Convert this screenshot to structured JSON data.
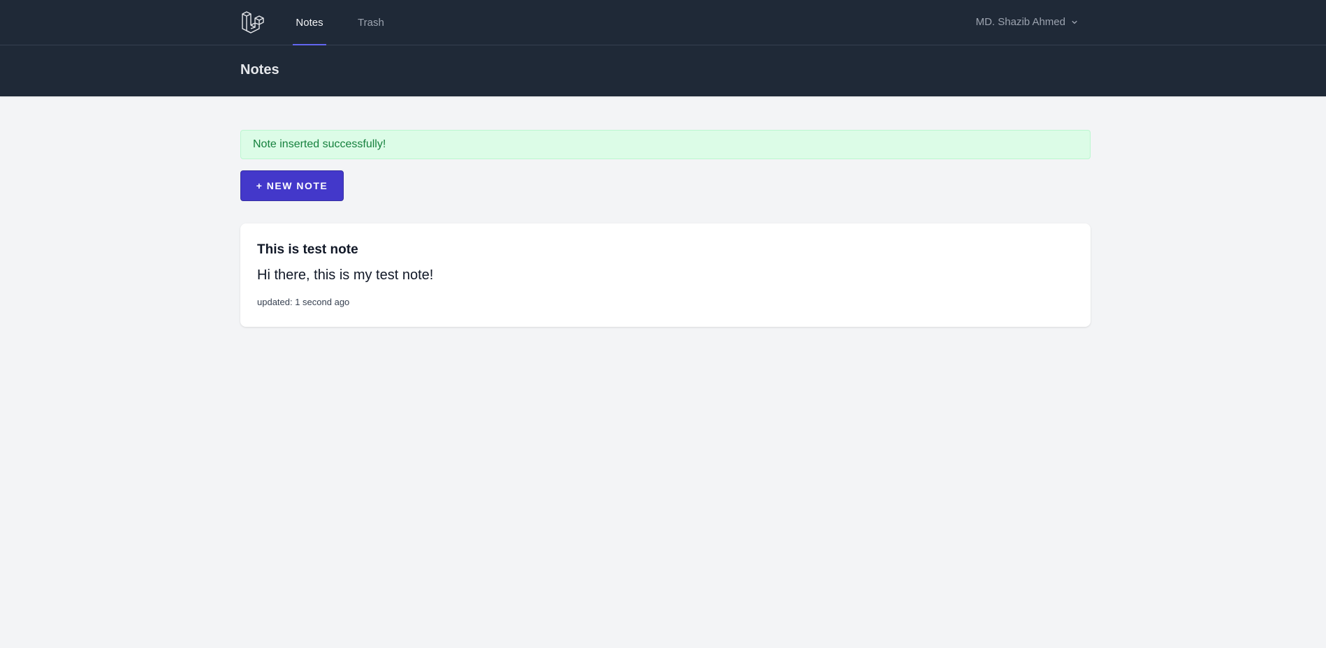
{
  "nav": {
    "logo_icon": "laravel-logo-icon",
    "items": [
      {
        "label": "Notes",
        "active": true
      },
      {
        "label": "Trash",
        "active": false
      }
    ],
    "user": {
      "name": "MD. Shazib Ahmed",
      "icon": "chevron-down-icon"
    }
  },
  "header": {
    "title": "Notes"
  },
  "alert": {
    "message": "Note inserted successfully!"
  },
  "actions": {
    "new_note_label": "+ NEW NOTE"
  },
  "notes": [
    {
      "title": "This is test note",
      "body": "Hi there, this is my test note!",
      "updated": "updated: 1 second ago"
    }
  ],
  "colors": {
    "nav_bg": "#1f2937",
    "accent": "#4338ca",
    "success_bg": "#dcfce7",
    "success_text": "#15803d"
  }
}
